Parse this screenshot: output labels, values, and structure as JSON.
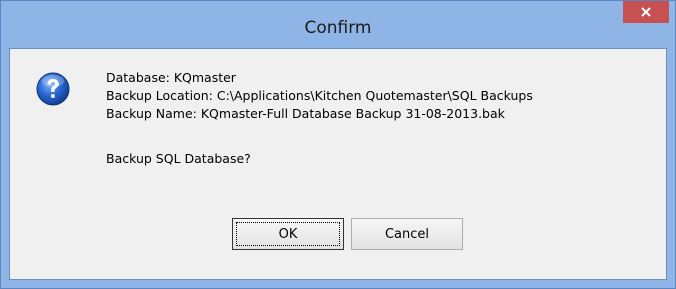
{
  "window": {
    "title": "Confirm"
  },
  "icons": {
    "close": "close-icon",
    "question": "question-icon"
  },
  "message": {
    "database_line": "Database: KQmaster",
    "location_line": "Backup Location: C:\\Applications\\Kitchen Quotemaster\\SQL Backups",
    "name_line": "Backup Name: KQmaster-Full Database Backup 31-08-2013.bak",
    "question": "Backup SQL Database?"
  },
  "buttons": {
    "ok_label": "OK",
    "cancel_label": "Cancel"
  },
  "colors": {
    "frame": "#8fb5e6",
    "close_button": "#c75050",
    "client_background": "#f0f0f0"
  }
}
